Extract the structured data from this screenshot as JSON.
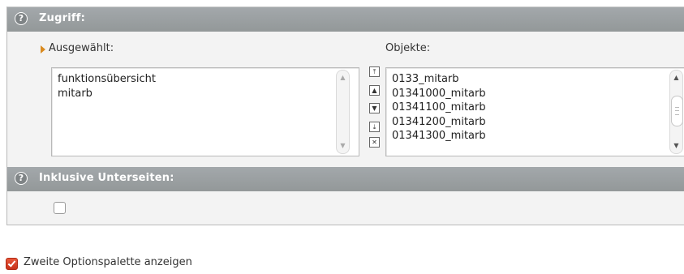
{
  "zugriff": {
    "title": "Zugriff:",
    "help_glyph": "?",
    "selected_label": "Ausgewählt:",
    "objects_label": "Objekte:",
    "selected_items": [
      "funktionsübersicht",
      "mitarb"
    ],
    "object_items": [
      "0133_mitarb",
      "01341000_mitarb",
      "01341100_mitarb",
      "01341200_mitarb",
      "01341300_mitarb"
    ],
    "move_buttons": {
      "top": "⤒",
      "up": "▲",
      "down": "▼",
      "bottom": "⤓",
      "remove": "✕"
    },
    "scroll_up_glyph": "▲",
    "scroll_down_glyph": "▼"
  },
  "inklusive": {
    "title": "Inklusive Unterseiten:",
    "help_glyph": "?",
    "checked": false
  },
  "footer": {
    "option_label": "Zweite Optionspalette anzeigen",
    "checked": true
  },
  "colors": {
    "section_bar": "#999ea0",
    "accent_arrow": "#d98a1f",
    "checkbox_checked": "#d8452a"
  }
}
